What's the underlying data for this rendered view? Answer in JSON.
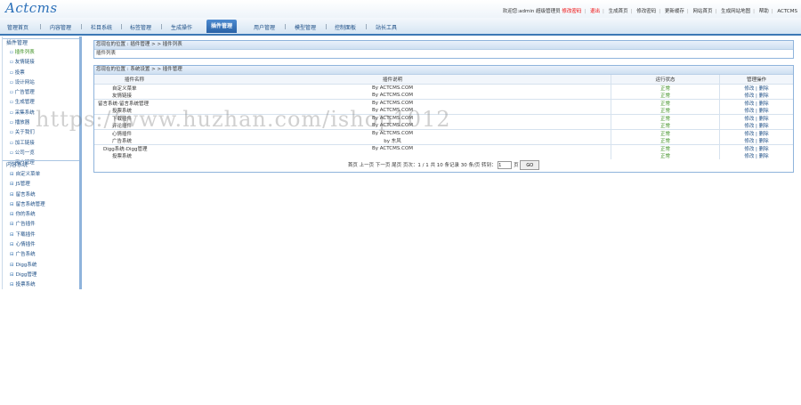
{
  "logo": "Actcms",
  "toplinks": {
    "welcome": "欢迎您:admin 超级管理员",
    "change_pwd": "修改密码",
    "logout": "退出",
    "links": [
      "生成首页",
      "修改密码",
      "更新缓存",
      "网站首页",
      "生成网站地图",
      "帮助",
      "ACTCMS"
    ]
  },
  "nav": [
    "管理首页",
    "内容管理",
    "栏目系统",
    "标签管理",
    "生成操作",
    "插件管理",
    "用户管理",
    "模型管理",
    "控制面板",
    "站长工具"
  ],
  "sidebar": {
    "group1_title": "插件管理",
    "group1_items": [
      "插件列表",
      "友情链接",
      "投票",
      "设计网站",
      "广告管理",
      "生成管理",
      "采集系统",
      "播放器",
      "关于我们",
      "加工链接",
      "公司一览",
      "用户管理"
    ],
    "group2_title": "内容系统",
    "group2_items": [
      "自定义菜单",
      "JS管理",
      "留言系统",
      "留言系统管理",
      "你的系统",
      "广告插件",
      "下载插件",
      "心情插件",
      "广告系统",
      "Digg系统",
      "Digg管理",
      "投票系统"
    ]
  },
  "panel1": {
    "header": "您现在的位置 : 插件管理 > > 插件列表",
    "body": "插件列表"
  },
  "panel2": {
    "header": "您现在的位置 : 系统设置 > > 插件管理",
    "columns": [
      "插件名称",
      "插件说明",
      "运行状态",
      "管理操作"
    ],
    "rows": [
      {
        "name": "自定义菜单",
        "desc": "By ACTCMS.COM",
        "status": "正常",
        "ops": "修改 | 删除"
      },
      {
        "name": "友情链接",
        "desc": "By ACTCMS.COM",
        "status": "正常",
        "ops": "修改 | 删除"
      },
      {
        "name": "留言系统-留言系统管理",
        "desc": "By ACTCMS.COM",
        "status": "正常",
        "ops": "修改 | 删除"
      },
      {
        "name": "投票系统",
        "desc": "By ACTCMS.COM",
        "status": "正常",
        "ops": "修改 | 删除"
      },
      {
        "name": "下载插件",
        "desc": "By ACTCMS.COM",
        "status": "正常",
        "ops": "修改 | 删除"
      },
      {
        "name": "评论插件",
        "desc": "By ACTCMS.COM",
        "status": "正常",
        "ops": "修改 | 删除"
      },
      {
        "name": "心情插件",
        "desc": "By ACTCMS.COM",
        "status": "正常",
        "ops": "修改 | 删除"
      },
      {
        "name": "广告系统",
        "desc": "by 东风",
        "status": "正常",
        "ops": "修改 | 删除"
      },
      {
        "name": "Digg系统-Digg管理",
        "desc": "By ACTCMS.COM",
        "status": "正常",
        "ops": "修改 | 删除"
      },
      {
        "name": "投票系统",
        "desc": "",
        "status": "正常",
        "ops": "修改 | 删除"
      }
    ],
    "pager": {
      "text": "首页 上一页 下一页 尾页 页次：1 / 1 共 10 条记录 30 条/页 转到：",
      "page_value": "1",
      "unit": "页",
      "go": "GO"
    }
  },
  "watermark": "https://www.huzhan.com/ishop1012"
}
